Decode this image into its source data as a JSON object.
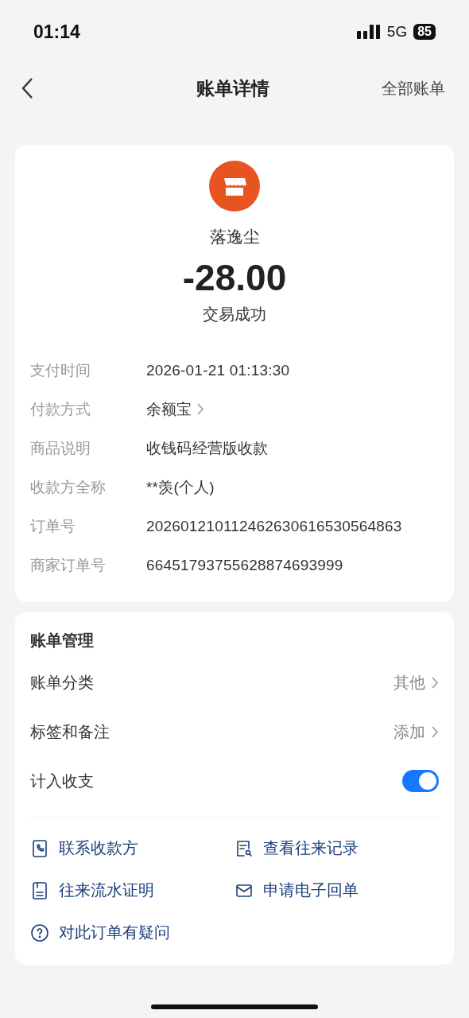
{
  "status_bar": {
    "time": "01:14",
    "network": "5G",
    "battery": "85"
  },
  "nav": {
    "title": "账单详情",
    "action": "全部账单"
  },
  "summary": {
    "merchant": "落逸尘",
    "amount": "-28.00",
    "status": "交易成功"
  },
  "details": [
    {
      "kind": "text",
      "label": "支付时间",
      "value": "2026-01-21 01:13:30"
    },
    {
      "kind": "link",
      "label": "付款方式",
      "value": "余额宝"
    },
    {
      "kind": "text",
      "label": "商品说明",
      "value": "收钱码经营版收款"
    },
    {
      "kind": "text",
      "label": "收款方全称",
      "value": "**羡(个人)"
    },
    {
      "kind": "text",
      "label": "订单号",
      "value": "202601210112462630616530564863"
    },
    {
      "kind": "text",
      "label": "商家订单号",
      "value": "66451793755628874693999"
    }
  ],
  "management": {
    "title": "账单管理",
    "rows": [
      {
        "kind": "link",
        "label": "账单分类",
        "value": "其他"
      },
      {
        "kind": "link",
        "label": "标签和备注",
        "value": "添加"
      },
      {
        "kind": "toggle",
        "label": "计入收支",
        "on": true
      }
    ]
  },
  "actions": [
    {
      "kind": "phone",
      "label": "联系收款方"
    },
    {
      "kind": "search-doc",
      "label": "查看往来记录"
    },
    {
      "kind": "doc",
      "label": "往来流水证明"
    },
    {
      "kind": "mail",
      "label": "申请电子回单"
    },
    {
      "kind": "help",
      "label": "对此订单有疑问"
    }
  ]
}
